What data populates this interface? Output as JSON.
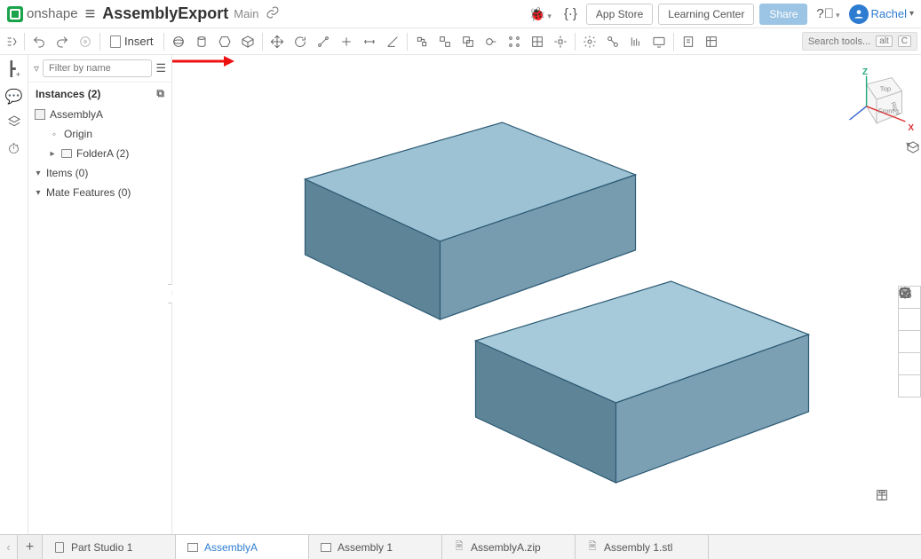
{
  "app": {
    "brand": "onshape",
    "doc_title": "AssemblyExport",
    "doc_sub": "Main",
    "buttons": {
      "app_store": "App Store",
      "learning": "Learning Center",
      "share": "Share"
    },
    "user": {
      "name": "Rachel"
    }
  },
  "toolbar": {
    "insert": "Insert",
    "search_placeholder": "Search tools...",
    "kbd1": "alt",
    "kbd2": "C"
  },
  "panel": {
    "filter_placeholder": "Filter by name",
    "instances_header": "Instances (2)",
    "items": {
      "assembly": "AssemblyA",
      "origin": "Origin",
      "folder": "FolderA (2)",
      "items": "Items (0)",
      "mates": "Mate Features (0)"
    }
  },
  "viewcube": {
    "top": "Top",
    "front": "Front",
    "right": "Right",
    "z": "Z",
    "x": "X"
  },
  "tabs": [
    {
      "label": "Part Studio 1",
      "kind": "ps"
    },
    {
      "label": "AssemblyA",
      "kind": "asm",
      "active": true
    },
    {
      "label": "Assembly 1",
      "kind": "asm"
    },
    {
      "label": "AssemblyA.zip",
      "kind": "zip"
    },
    {
      "label": "Assembly 1.stl",
      "kind": "zip"
    }
  ]
}
